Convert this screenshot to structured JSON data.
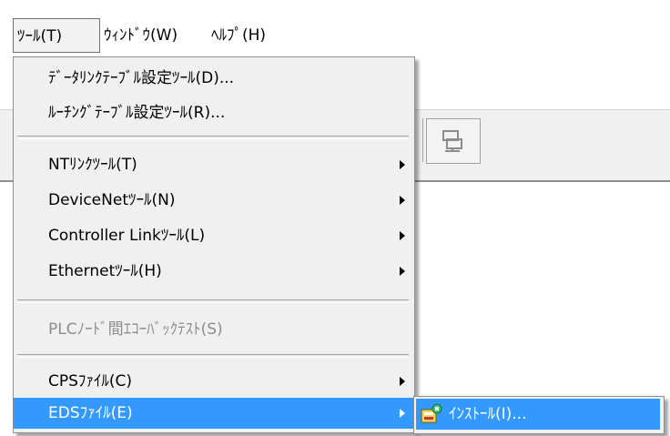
{
  "menubar": {
    "tools": "ﾂｰﾙ(T)",
    "window": "ｳｨﾝﾄﾞｳ(W)",
    "help": "ﾍﾙﾌﾟ(H)"
  },
  "tools_menu": {
    "items": [
      {
        "label": "ﾃﾞｰﾀﾘﾝｸﾃｰﾌﾞﾙ設定ﾂｰﾙ(D)..."
      },
      {
        "label": "ﾙｰﾁﾝｸﾞﾃｰﾌﾞﾙ設定ﾂｰﾙ(R)..."
      },
      {
        "label": "NTﾘﾝｸﾂｰﾙ(T)"
      },
      {
        "label": "DeviceNetﾂｰﾙ(N)"
      },
      {
        "label": "Controller Linkﾂｰﾙ(L)"
      },
      {
        "label": "Ethernetﾂｰﾙ(H)"
      },
      {
        "label": "PLCﾉｰﾄﾞ間ｴｺｰﾊﾞｯｸﾃｽﾄ(S)"
      },
      {
        "label": "CPSﾌｧｲﾙ(C)"
      },
      {
        "label": "EDSﾌｧｲﾙ(E)"
      }
    ]
  },
  "eds_submenu": {
    "install_label": "ｲﾝｽﾄｰﾙ(I)...",
    "install_icon": "install-eds-icon"
  },
  "colors": {
    "selection": "#3399ff",
    "menu_bg": "#f0f0f0",
    "disabled_text": "#8d8d8d"
  }
}
